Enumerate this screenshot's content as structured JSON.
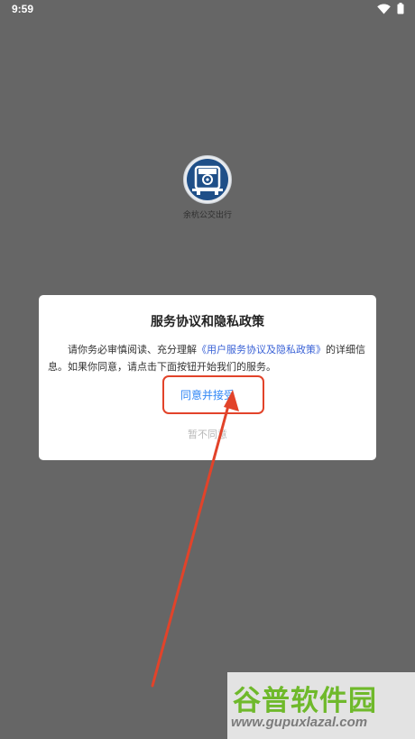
{
  "status_bar": {
    "time": "9:59",
    "icons": [
      "wifi-icon",
      "battery-icon"
    ]
  },
  "app": {
    "name": "余杭公交出行",
    "logo_icon": "bus-logo-icon"
  },
  "dialog": {
    "title": "服务协议和隐私政策",
    "body_prefix": "请你务必审慎阅读、充分理解",
    "policy_link": "《用户服务协议及隐私政策》",
    "body_suffix": "的详细信息。如果你同意，请点击下面按钮开始我们的服务。",
    "agree_label": "同意并接受",
    "disagree_label": "暂不同意"
  },
  "annotation": {
    "color": "#e2432a"
  },
  "watermark": {
    "cn_text": "谷普软件园",
    "url": "www.gupuxlazal.com"
  },
  "colors": {
    "overlay": "#666666",
    "link": "#3a62d6",
    "agree": "#2f86f5",
    "disagree": "#b8b8b8"
  }
}
